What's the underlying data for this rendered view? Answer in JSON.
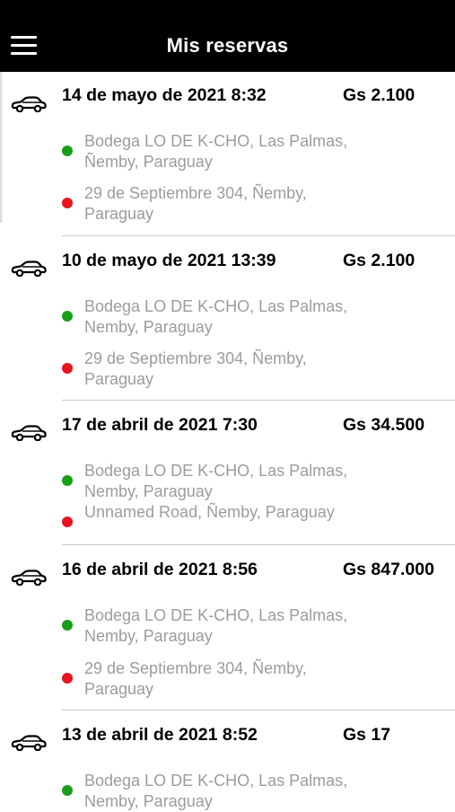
{
  "appbar": {
    "title": "Mis reservas"
  },
  "icons": {
    "menu": "hamburger-menu-icon",
    "car": "car-icon"
  },
  "colors": {
    "header_bg": "#000000",
    "origin_dot": "#1a9e1a",
    "destination_dot": "#e8141e",
    "address_text": "#9c9c9c"
  },
  "reservations": [
    {
      "date": "14 de mayo de 2021 8:32",
      "price": "Gs 2.100",
      "origin": "Bodega LO DE K-CHO, Las Palmas, Ñemby, Paraguay",
      "destination": "29 de Septiembre 304, Ñemby, Paraguay"
    },
    {
      "date": "10 de mayo de 2021 13:39",
      "price": "Gs 2.100",
      "origin": "Bodega LO DE K-CHO, Las Palmas, Nemby, Paraguay",
      "destination": "29 de Septiembre 304, Ñemby, Paraguay"
    },
    {
      "date": "17 de abril de 2021 7:30",
      "price": "Gs 34.500",
      "origin": "Bodega LO DE K-CHO, Las Palmas, Nemby, Paraguay",
      "destination": "Unnamed Road, Ñemby, Paraguay"
    },
    {
      "date": "16 de abril de 2021 8:56",
      "price": "Gs 847.000",
      "origin": "Bodega LO DE K-CHO, Las Palmas, Nemby, Paraguay",
      "destination": "29 de Septiembre 304, Ñemby, Paraguay"
    },
    {
      "date": "13 de abril de 2021 8:52",
      "price": "Gs 17",
      "origin": "Bodega LO DE K-CHO, Las Palmas, Nemby, Paraguay",
      "destination": ""
    }
  ]
}
